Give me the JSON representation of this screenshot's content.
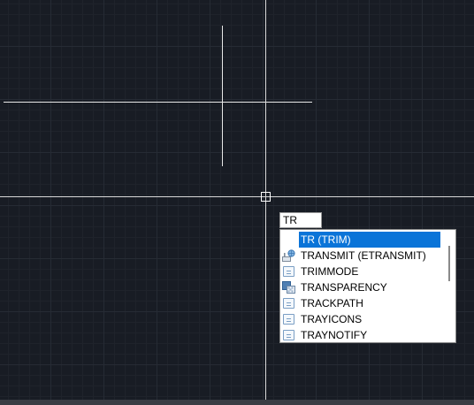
{
  "command_line": {
    "input_value": "TR"
  },
  "autocomplete": {
    "items": [
      {
        "label": "TR (TRIM)",
        "icon": "command-icon",
        "selected": true
      },
      {
        "label": "TRANSMIT (ETRANSMIT)",
        "icon": "transmit-icon",
        "selected": false
      },
      {
        "label": "TRIMMODE",
        "icon": "system-variable-icon",
        "selected": false
      },
      {
        "label": "TRANSPARENCY",
        "icon": "transparency-icon",
        "selected": false
      },
      {
        "label": "TRACKPATH",
        "icon": "system-variable-icon",
        "selected": false
      },
      {
        "label": "TRAYICONS",
        "icon": "system-variable-icon",
        "selected": false
      },
      {
        "label": "TRAYNOTIFY",
        "icon": "system-variable-icon",
        "selected": false
      }
    ]
  },
  "colors": {
    "canvas_background": "#181c24",
    "selection": "#0a74d8",
    "crosshair": "#d8d8d8"
  }
}
